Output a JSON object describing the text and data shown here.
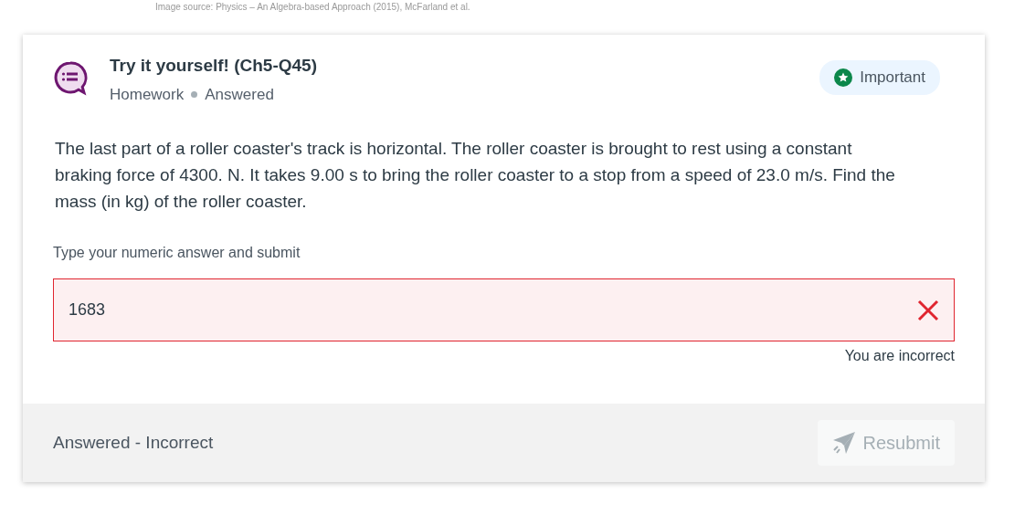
{
  "image_source": "Image source: Physics – An Algebra-based Approach (2015), McFarland et al.",
  "question": {
    "title": "Try it yourself! (Ch5-Q45)",
    "type": "Homework",
    "status": "Answered",
    "important": true,
    "important_label": "Important",
    "text": "The last part of a roller coaster's track is horizontal. The roller coaster is brought to rest using a constant braking force of 4300. N. It takes 9.00 s to bring the roller coaster to a stop from a speed of 23.0 m/s. Find the mass (in kg) of the roller coaster."
  },
  "answer": {
    "label": "Type your numeric answer and submit",
    "value": "1683",
    "correct": false,
    "feedback": "You are incorrect"
  },
  "footer": {
    "status": "Answered - Incorrect",
    "button": {
      "label": "Resubmit",
      "disabled": true
    }
  }
}
